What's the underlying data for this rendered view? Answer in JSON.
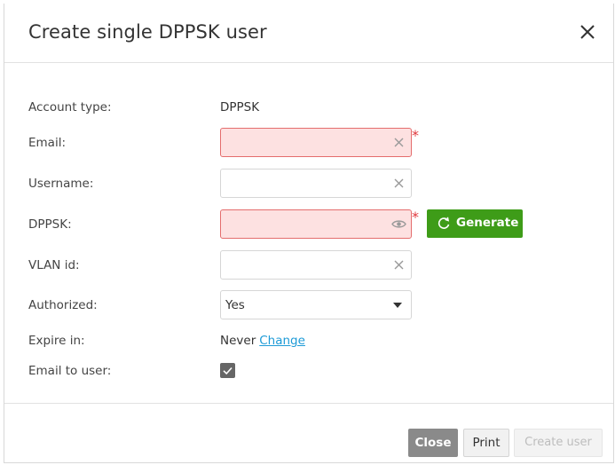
{
  "dialog": {
    "title": "Create single DPPSK user"
  },
  "form": {
    "account_type": {
      "label": "Account type:",
      "value": "DPPSK"
    },
    "email": {
      "label": "Email:",
      "value": "",
      "placeholder": "",
      "required_marker": "*",
      "state": "error"
    },
    "username": {
      "label": "Username:",
      "value": "",
      "placeholder": ""
    },
    "dppsk": {
      "label": "DPPSK:",
      "value": "",
      "placeholder": "",
      "required_marker": "*",
      "state": "error"
    },
    "generate_button": {
      "label": "Generate",
      "icon": "refresh-icon",
      "color": "#3e9c18"
    },
    "vlan_id": {
      "label": "VLAN id:",
      "value": "",
      "placeholder": ""
    },
    "authorized": {
      "label": "Authorized:",
      "selected": "Yes"
    },
    "expire_in": {
      "label": "Expire in:",
      "value": "Never",
      "link": "Change"
    },
    "email_to_user": {
      "label": "Email to user:",
      "checked": true
    }
  },
  "footer": {
    "close_label": "Close",
    "print_label": "Print",
    "create_label": "Create user"
  },
  "colors": {
    "error_bg": "#fde1e1",
    "error_border": "#e46d6d",
    "link": "#1e9bd7",
    "required": "#e0393e"
  }
}
